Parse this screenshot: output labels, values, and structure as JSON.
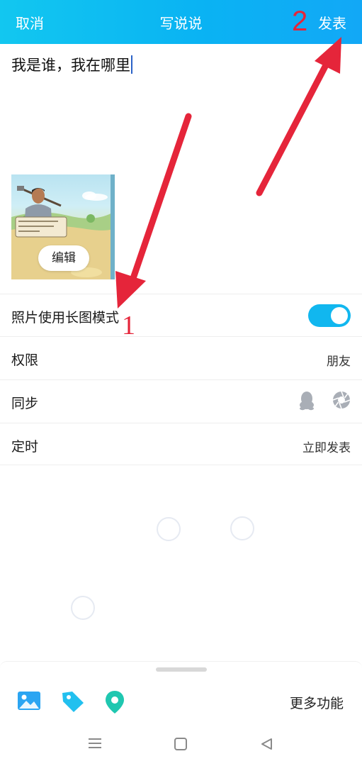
{
  "header": {
    "cancel_label": "取消",
    "title": "写说说",
    "publish_label": "发表",
    "annotation_number": "2"
  },
  "composer": {
    "text": "我是谁，我在哪里"
  },
  "thumbnail": {
    "edit_label": "编辑"
  },
  "settings": {
    "long_image": {
      "label": "照片使用长图模式",
      "enabled": true
    },
    "annotation_number": "1",
    "permission": {
      "label": "权限",
      "value": "朋友"
    },
    "sync": {
      "label": "同步",
      "icons": [
        "qq-penguin-icon",
        "camera-aperture-icon"
      ]
    },
    "schedule": {
      "label": "定时",
      "value": "立即发表"
    }
  },
  "toolbar": {
    "tools": [
      "image-icon",
      "tag-icon",
      "location-icon"
    ],
    "more_label": "更多功能"
  },
  "colors": {
    "header_gradient_start": "#12c7f0",
    "header_gradient_end": "#12a8f6",
    "toggle_on": "#11b7ef",
    "annotation_red": "#e5253a",
    "location_teal": "#1fc7b0",
    "image_blue": "#2ba5f2"
  }
}
